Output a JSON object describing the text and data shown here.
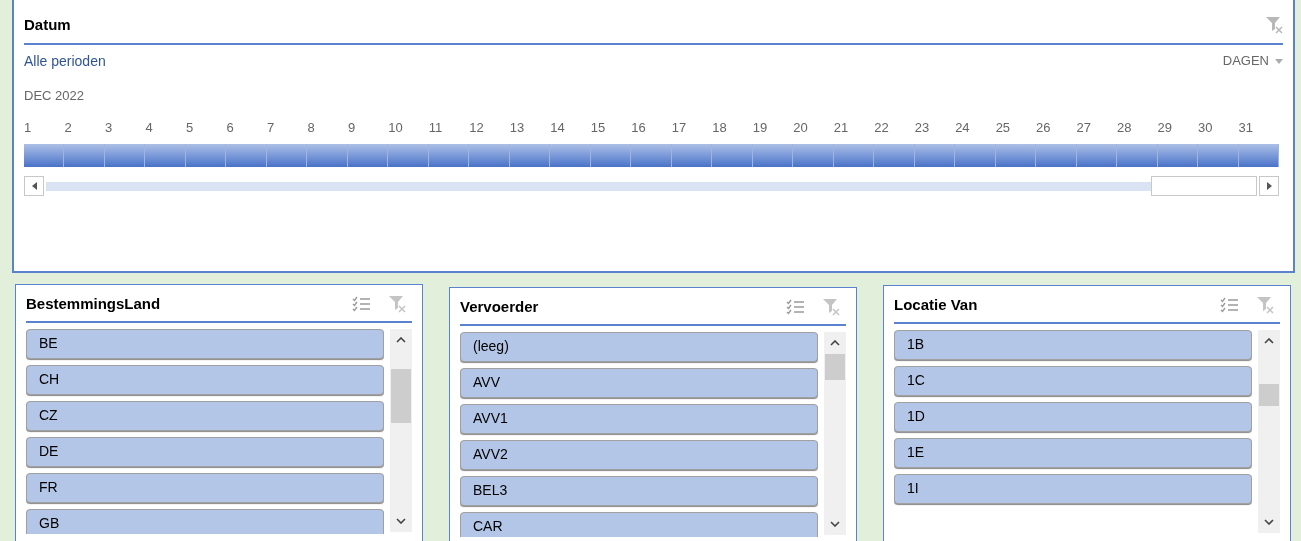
{
  "timeline": {
    "title": "Datum",
    "period_link": "Alle perioden",
    "level_selector": "DAGEN",
    "period_label": "DEC 2022",
    "days": [
      {
        "label": "1",
        "selected": true
      },
      {
        "label": "2",
        "selected": true
      },
      {
        "label": "3",
        "selected": true
      },
      {
        "label": "4",
        "selected": true
      },
      {
        "label": "5",
        "selected": true
      },
      {
        "label": "6",
        "selected": true
      },
      {
        "label": "7",
        "selected": true
      },
      {
        "label": "8",
        "selected": true
      },
      {
        "label": "9",
        "selected": true
      },
      {
        "label": "10",
        "selected": true
      },
      {
        "label": "11",
        "selected": true
      },
      {
        "label": "12",
        "selected": true
      },
      {
        "label": "13",
        "selected": true
      },
      {
        "label": "14",
        "selected": true
      },
      {
        "label": "15",
        "selected": true
      },
      {
        "label": "16",
        "selected": true
      },
      {
        "label": "17",
        "selected": true
      },
      {
        "label": "18",
        "selected": true
      },
      {
        "label": "19",
        "selected": true
      },
      {
        "label": "20",
        "selected": true
      },
      {
        "label": "21",
        "selected": true
      },
      {
        "label": "22",
        "selected": true
      },
      {
        "label": "23",
        "selected": true
      },
      {
        "label": "24",
        "selected": true
      },
      {
        "label": "25",
        "selected": true
      },
      {
        "label": "26",
        "selected": true
      },
      {
        "label": "27",
        "selected": true
      },
      {
        "label": "28",
        "selected": true
      },
      {
        "label": "29",
        "selected": true
      },
      {
        "label": "30",
        "selected": true
      },
      {
        "label": "31",
        "selected": true
      }
    ]
  },
  "slicers": [
    {
      "title": "BestemmingsLand",
      "items": [
        {
          "label": "BE",
          "selected": true
        },
        {
          "label": "CH",
          "selected": true
        },
        {
          "label": "CZ",
          "selected": true
        },
        {
          "label": "DE",
          "selected": true
        },
        {
          "label": "FR",
          "selected": true
        },
        {
          "label": "GB",
          "selected": true
        }
      ]
    },
    {
      "title": "Vervoerder",
      "items": [
        {
          "label": "(leeg)",
          "selected": true
        },
        {
          "label": "AVV",
          "selected": true
        },
        {
          "label": "AVV1",
          "selected": true
        },
        {
          "label": "AVV2",
          "selected": true
        },
        {
          "label": "BEL3",
          "selected": true
        },
        {
          "label": "CAR",
          "selected": true
        }
      ]
    },
    {
      "title": "Locatie Van",
      "items": [
        {
          "label": "1B",
          "selected": true
        },
        {
          "label": "1C",
          "selected": true
        },
        {
          "label": "1D",
          "selected": true
        },
        {
          "label": "1E",
          "selected": true
        },
        {
          "label": "1I",
          "selected": true
        }
      ]
    }
  ]
}
